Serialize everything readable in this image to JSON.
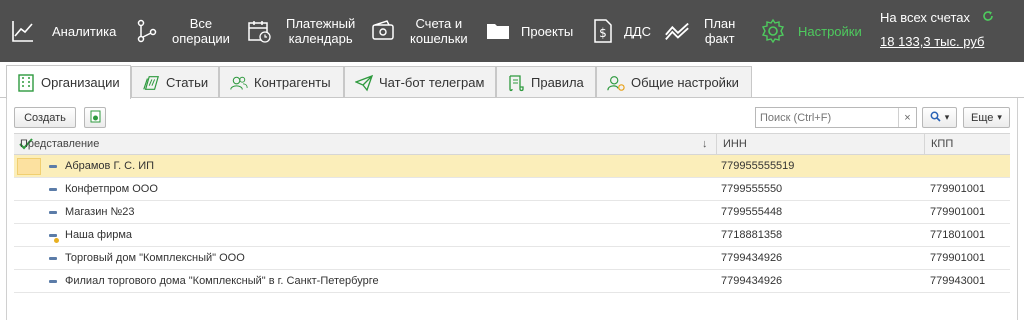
{
  "nav": {
    "items": [
      {
        "label": "Аналитика"
      },
      {
        "label": "Все\nоперации"
      },
      {
        "label": "Платежный\nкалендарь"
      },
      {
        "label": "Счета и\nкошельки"
      },
      {
        "label": "Проекты"
      },
      {
        "label": "ДДС"
      },
      {
        "label": "План\nфакт"
      },
      {
        "label": "Настройки"
      }
    ],
    "active_color": "#4ecb5e",
    "background": "#4f4f4f"
  },
  "totals": {
    "label": "На всех счетах",
    "value": "18 133,3 тыс. руб"
  },
  "tabs": [
    {
      "label": "Организации"
    },
    {
      "label": "Статьи"
    },
    {
      "label": "Контрагенты"
    },
    {
      "label": "Чат-бот телеграм"
    },
    {
      "label": "Правила"
    },
    {
      "label": "Общие настройки"
    }
  ],
  "toolbar": {
    "create_label": "Создать",
    "search_placeholder": "Поиск (Ctrl+F)",
    "search_clear": "×",
    "more_label": "Еще",
    "dropdown_arrow": "▾"
  },
  "table": {
    "columns": {
      "name": "Представление",
      "inn": "ИНН",
      "kpp": "КПП",
      "sort_arrow": "↓"
    },
    "rows": [
      {
        "name": "Абрамов Г. С. ИП",
        "inn": "779955555519",
        "kpp": ""
      },
      {
        "name": "Конфетпром ООО",
        "inn": "7799555550",
        "kpp": "779901001"
      },
      {
        "name": "Магазин №23",
        "inn": "7799555448",
        "kpp": "779901001"
      },
      {
        "name": "Наша фирма",
        "inn": "7718881358",
        "kpp": "771801001"
      },
      {
        "name": "Торговый дом \"Комплексный\" ООО",
        "inn": "7799434926",
        "kpp": "779901001"
      },
      {
        "name": "Филиал торгового дома \"Комплексный\" в г. Санкт-Петербурге",
        "inn": "7799434926",
        "kpp": "779943001"
      }
    ]
  }
}
